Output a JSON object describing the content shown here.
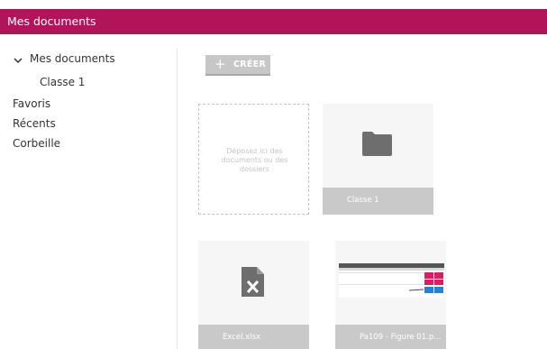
{
  "header": {
    "title": "Mes documents"
  },
  "sidebar": {
    "root": "Mes documents",
    "child": "Classe 1",
    "favorites": "Favoris",
    "recent": "Récents",
    "trash": "Corbeille"
  },
  "toolbar": {
    "create_label": "CRÉER"
  },
  "dropzone": {
    "text": "Déposez ici des documents ou des dossiers"
  },
  "items": [
    {
      "name": "Classe 1",
      "type": "folder"
    },
    {
      "name": "Excel.xlsx",
      "type": "xlsx"
    },
    {
      "name": "Pa109 - Figure 01.p...",
      "type": "image"
    }
  ],
  "colors": {
    "accent": "#b0155a",
    "tile": "#f6f6f6",
    "caption": "#c9c9c9",
    "icon": "#6e6e6e"
  },
  "icons": [
    "chevron-down-icon",
    "plus-icon",
    "folder-icon",
    "excel-file-icon"
  ]
}
